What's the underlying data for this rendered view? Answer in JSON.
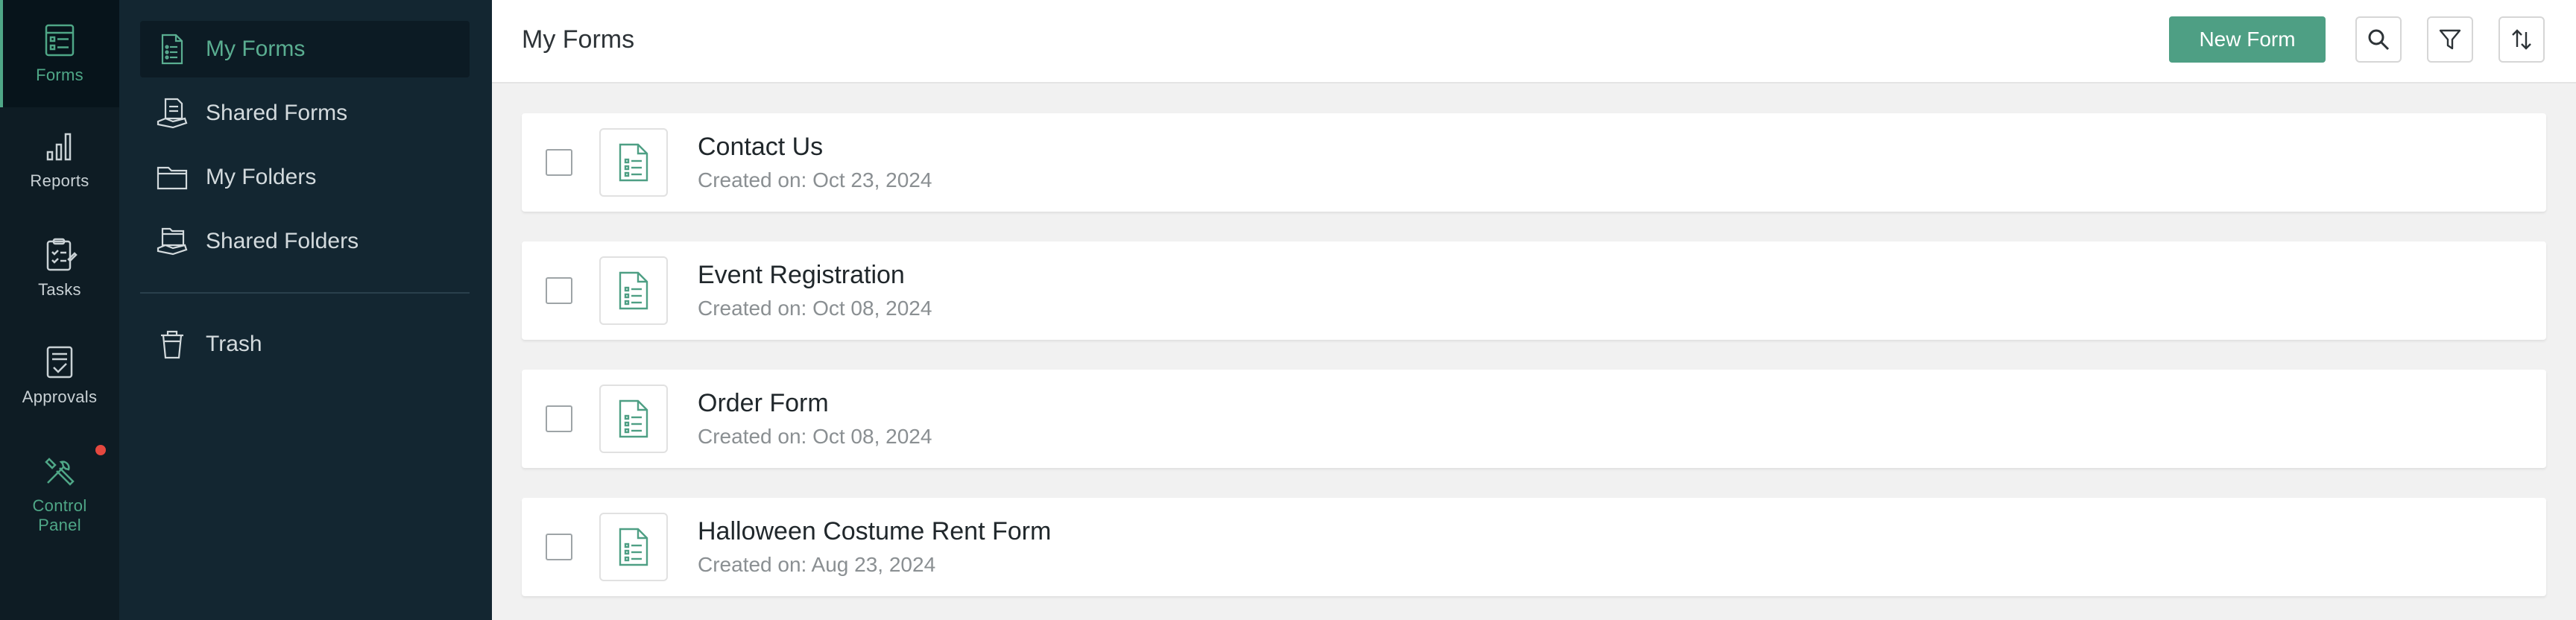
{
  "rail": [
    {
      "label": "Forms",
      "icon": "forms-icon",
      "active": true
    },
    {
      "label": "Reports",
      "icon": "reports-icon"
    },
    {
      "label": "Tasks",
      "icon": "tasks-icon"
    },
    {
      "label": "Approvals",
      "icon": "approvals-icon"
    },
    {
      "label": "Control Panel",
      "icon": "control-panel-icon",
      "notification": true
    }
  ],
  "nav": {
    "items": [
      {
        "label": "My Forms",
        "icon": "form-document-icon",
        "active": true
      },
      {
        "label": "Shared Forms",
        "icon": "shared-forms-icon"
      },
      {
        "label": "My Folders",
        "icon": "folder-icon"
      },
      {
        "label": "Shared Folders",
        "icon": "shared-folder-icon"
      }
    ],
    "trash": {
      "label": "Trash",
      "icon": "trash-icon"
    }
  },
  "header": {
    "title": "My Forms",
    "new_form_label": "New Form",
    "actions": [
      "search-icon",
      "filter-icon",
      "sort-icon"
    ]
  },
  "forms": [
    {
      "title": "Contact Us",
      "created": "Created on: Oct 23, 2024"
    },
    {
      "title": "Event Registration",
      "created": "Created on: Oct 08, 2024"
    },
    {
      "title": "Order Form",
      "created": "Created on: Oct 08, 2024"
    },
    {
      "title": "Halloween Costume Rent Form",
      "created": "Created on: Aug 23, 2024"
    }
  ],
  "colors": {
    "accent": "#4e9f84",
    "rail_bg": "#0e1c24",
    "nav_bg": "#132631",
    "notification": "#e5483f"
  }
}
